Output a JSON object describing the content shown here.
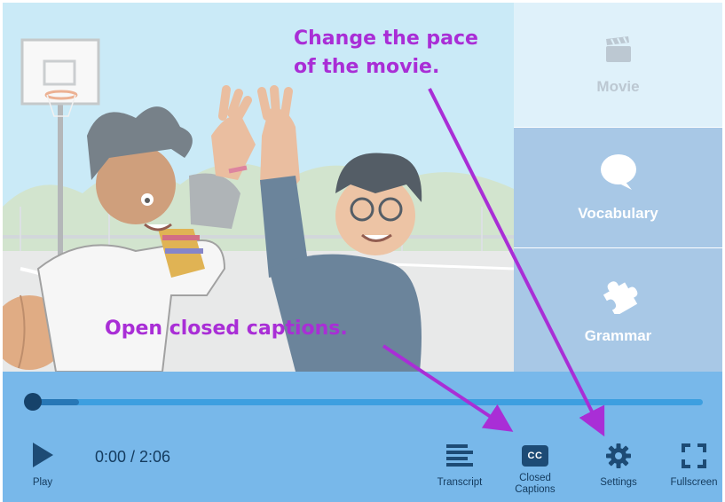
{
  "side_nav": {
    "items": [
      {
        "label": "Movie",
        "icon": "clapperboard-icon",
        "state": "selected"
      },
      {
        "label": "Vocabulary",
        "icon": "speech-bubble-icon"
      },
      {
        "label": "Grammar",
        "icon": "puzzle-piece-icon"
      }
    ]
  },
  "player": {
    "time": "0:00 / 2:06",
    "progress": 0.07,
    "play_label": "Play",
    "transcript_label": "Transcript",
    "cc_label_line1": "Closed",
    "cc_label_line2": "Captions",
    "cc_badge": "CC",
    "settings_label": "Settings",
    "fullscreen_label": "Fullscreen"
  },
  "annotations": {
    "pace_line1": "Change the pace",
    "pace_line2": "of the movie.",
    "captions": "Open closed captions."
  },
  "colors": {
    "annotation": "#a92ed6",
    "control_bar": "#78b8ea",
    "side_tab": "#a8c8e6",
    "side_tab_selected": "#dff1fa",
    "icon_dark": "#1d4b75"
  }
}
